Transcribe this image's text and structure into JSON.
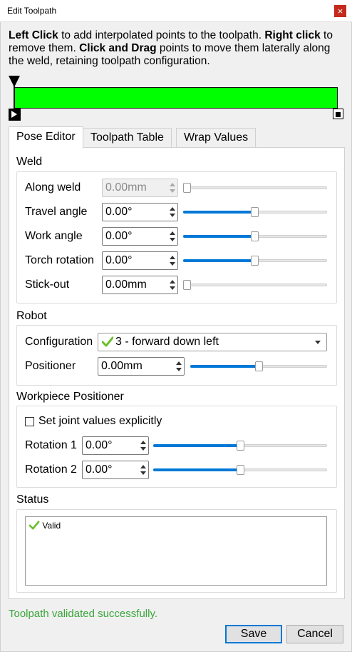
{
  "window": {
    "title": "Edit Toolpath",
    "close_glyph": "×"
  },
  "instructions": {
    "p1_bold": "Left Click",
    "p1": " to add interpolated points to the toolpath. ",
    "p2_bold": "Right click",
    "p2": " to remove them. ",
    "p3_bold": "Click and Drag",
    "p3": " points to move them laterally along the weld, retaining toolpath configuration."
  },
  "timeline": {
    "bar_color": "#00ff00"
  },
  "tabs": [
    {
      "label": "Pose Editor",
      "active": true
    },
    {
      "label": "Toolpath Table",
      "active": false
    },
    {
      "label": "Wrap Values",
      "active": false
    }
  ],
  "weld": {
    "title": "Weld",
    "rows": [
      {
        "label": "Along weld",
        "value": "0.00mm",
        "enabled": false,
        "slider": 0.0
      },
      {
        "label": "Travel angle",
        "value": "0.00°",
        "enabled": true,
        "slider": 0.5
      },
      {
        "label": "Work angle",
        "value": "0.00°",
        "enabled": true,
        "slider": 0.5
      },
      {
        "label": "Torch rotation",
        "value": "0.00°",
        "enabled": true,
        "slider": 0.5
      },
      {
        "label": "Stick-out",
        "value": "0.00mm",
        "enabled": true,
        "slider": 0.0
      }
    ]
  },
  "robot": {
    "title": "Robot",
    "configuration_label": "Configuration",
    "configuration_value": "3 - forward down left",
    "positioner_label": "Positioner",
    "positioner_value": "0.00mm",
    "positioner_slider": 0.5
  },
  "workpiece": {
    "title": "Workpiece Positioner",
    "checkbox_label": "Set joint values explicitly",
    "checkbox_checked": false,
    "rows": [
      {
        "label": "Rotation 1",
        "value": "0.00°",
        "slider": 0.5
      },
      {
        "label": "Rotation 2",
        "value": "0.00°",
        "slider": 0.5
      }
    ]
  },
  "status": {
    "title": "Status",
    "items": [
      {
        "text": "Valid",
        "icon": "check-icon"
      }
    ]
  },
  "footer": {
    "message": "Toolpath validated successfully.",
    "message_color": "#3aa53a",
    "save_label": "Save",
    "cancel_label": "Cancel"
  },
  "colors": {
    "accent": "#0078d7",
    "check": "#6cbf2a"
  }
}
